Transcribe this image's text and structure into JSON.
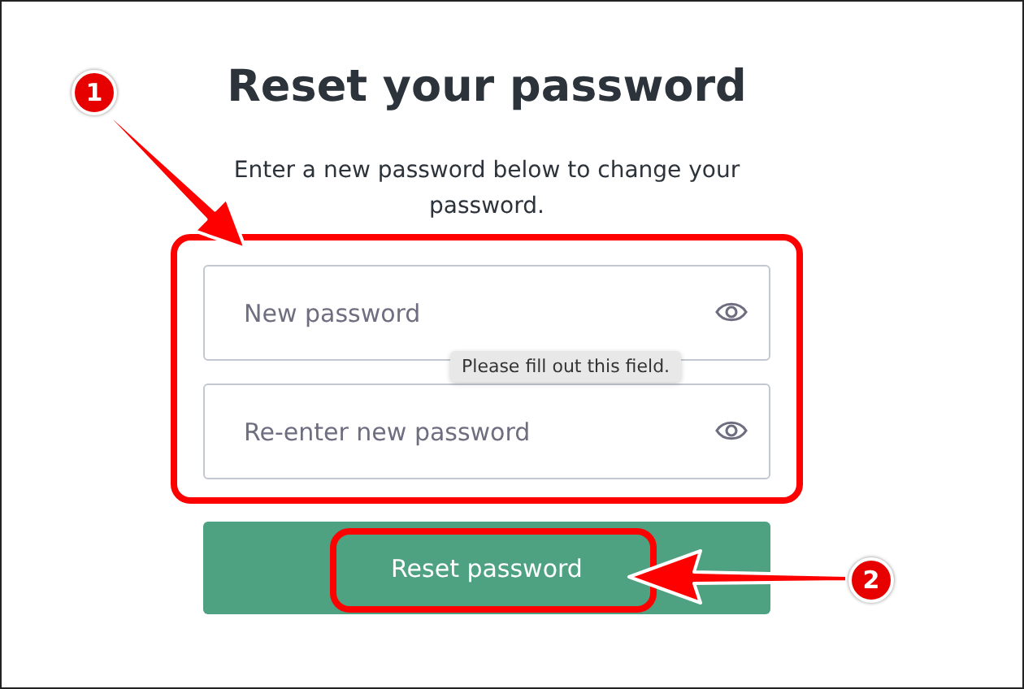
{
  "title": "Reset your password",
  "subtitle": "Enter a new password below to change your password.",
  "fields": [
    {
      "placeholder": "New password"
    },
    {
      "placeholder": "Re-enter new password"
    }
  ],
  "tooltip": "Please fill out this field.",
  "button": {
    "label": "Reset password"
  },
  "annotations": [
    {
      "label": "1"
    },
    {
      "label": "2"
    }
  ]
}
